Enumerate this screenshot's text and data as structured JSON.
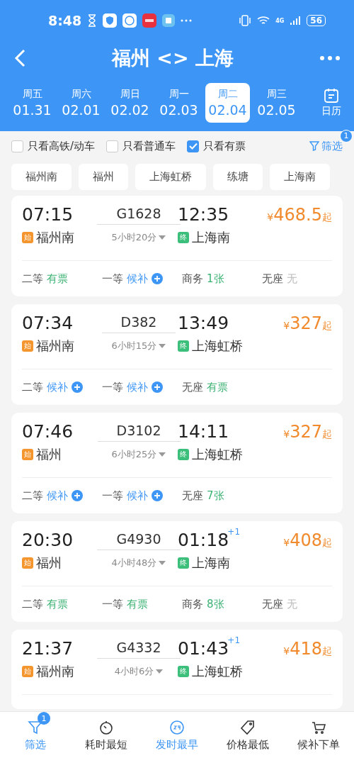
{
  "status_bar": {
    "time": "8:48",
    "battery": "56",
    "network": "4G"
  },
  "header": {
    "title": "福州 <> 上海"
  },
  "dates": [
    {
      "weekday": "周五",
      "date": "01.31",
      "selected": false
    },
    {
      "weekday": "周六",
      "date": "02.01",
      "selected": false
    },
    {
      "weekday": "周日",
      "date": "02.02",
      "selected": false
    },
    {
      "weekday": "周一",
      "date": "02.03",
      "selected": false
    },
    {
      "weekday": "周二",
      "date": "02.04",
      "selected": true
    },
    {
      "weekday": "周三",
      "date": "02.05",
      "selected": false
    }
  ],
  "calendar_button": {
    "label": "日历"
  },
  "filters": [
    {
      "label": "只看高铁/动车",
      "checked": false
    },
    {
      "label": "只看普通车",
      "checked": false
    },
    {
      "label": "只看有票",
      "checked": true
    }
  ],
  "filter_link": {
    "label": "筛选",
    "badge": "1"
  },
  "stations": [
    "福州南",
    "福州",
    "上海虹桥",
    "练塘",
    "上海南"
  ],
  "trains": [
    {
      "depart": "07:15",
      "number": "G1628",
      "arrive": "12:35",
      "currency": "¥",
      "price": "468.5",
      "price_suffix": "起",
      "from_badge": "始",
      "from": "福州南",
      "duration": "5小时20分",
      "to_badge": "终",
      "to": "上海南",
      "seats": [
        {
          "class": "二等",
          "status": "有票",
          "kind": "available"
        },
        {
          "class": "一等",
          "status": "候补",
          "kind": "waitlist"
        },
        {
          "class": "商务",
          "status": "1张",
          "kind": "available"
        },
        {
          "class": "无座",
          "status": "无",
          "kind": "none"
        }
      ]
    },
    {
      "depart": "07:34",
      "number": "D382",
      "arrive": "13:49",
      "currency": "¥",
      "price": "327",
      "price_suffix": "起",
      "from_badge": "始",
      "from": "福州南",
      "duration": "6小时15分",
      "to_badge": "终",
      "to": "上海虹桥",
      "seats": [
        {
          "class": "二等",
          "status": "候补",
          "kind": "waitlist"
        },
        {
          "class": "一等",
          "status": "候补",
          "kind": "waitlist"
        },
        {
          "class": "无座",
          "status": "有票",
          "kind": "available"
        }
      ]
    },
    {
      "depart": "07:46",
      "number": "D3102",
      "arrive": "14:11",
      "currency": "¥",
      "price": "327",
      "price_suffix": "起",
      "from_badge": "始",
      "from": "福州",
      "duration": "6小时25分",
      "to_badge": "终",
      "to": "上海虹桥",
      "seats": [
        {
          "class": "二等",
          "status": "候补",
          "kind": "waitlist"
        },
        {
          "class": "一等",
          "status": "候补",
          "kind": "waitlist"
        },
        {
          "class": "无座",
          "status": "7张",
          "kind": "available"
        }
      ]
    },
    {
      "depart": "20:30",
      "number": "G4930",
      "arrive": "01:18",
      "next_day": "+1",
      "currency": "¥",
      "price": "408",
      "price_suffix": "起",
      "from_badge": "始",
      "from": "福州",
      "duration": "4小时48分",
      "to_badge": "终",
      "to": "上海南",
      "seats": [
        {
          "class": "二等",
          "status": "有票",
          "kind": "available"
        },
        {
          "class": "一等",
          "status": "有票",
          "kind": "available"
        },
        {
          "class": "商务",
          "status": "8张",
          "kind": "available"
        },
        {
          "class": "无座",
          "status": "无",
          "kind": "none"
        }
      ]
    },
    {
      "depart": "21:37",
      "number": "G4332",
      "arrive": "01:43",
      "next_day": "+1",
      "currency": "¥",
      "price": "418",
      "price_suffix": "起",
      "from_badge": "始",
      "from": "福州南",
      "duration": "4小时6分",
      "to_badge": "终",
      "to": "上海虹桥"
    }
  ],
  "bottom_nav": [
    {
      "label": "筛选",
      "active": true,
      "badge": "1"
    },
    {
      "label": "耗时最短",
      "active": false
    },
    {
      "label": "发时最早",
      "active": true
    },
    {
      "label": "价格最低",
      "active": false
    },
    {
      "label": "候补下单",
      "active": false
    }
  ]
}
